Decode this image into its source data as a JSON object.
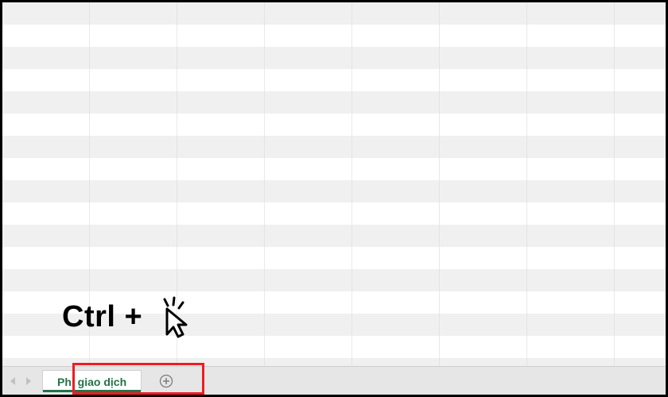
{
  "annotation": {
    "text": "Ctrl +"
  },
  "tabbar": {
    "active_tab": "Phí giao dịch",
    "new_sheet_symbol": "⊕",
    "nav_prev": "◂",
    "nav_next": "▸"
  }
}
